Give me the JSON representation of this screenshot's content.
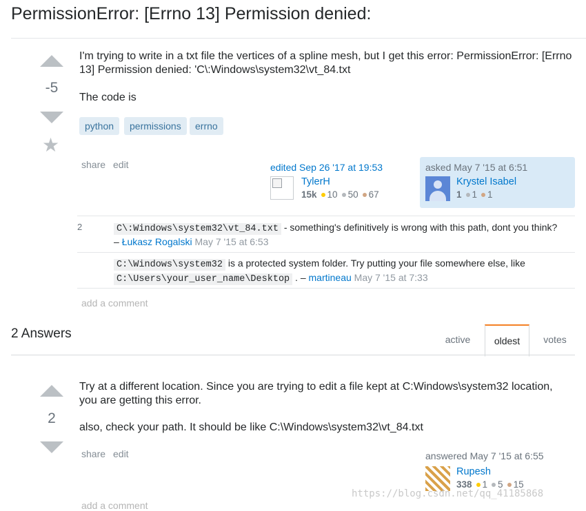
{
  "question": {
    "title": "PermissionError: [Errno 13] Permission denied:",
    "score": "-5",
    "body_p1": "I'm trying to write in a txt file the vertices of a spline mesh, but I get this error: PermissionError: [Errno 13] Permission denied: 'C\\:Windows\\system32\\vt_84.txt",
    "body_p2": "The code is",
    "tags": [
      "python",
      "permissions",
      "errno"
    ],
    "menu": {
      "share": "share",
      "edit": "edit"
    },
    "edited": {
      "action": "edited Sep 26 '17 at 19:53",
      "user": "TylerH",
      "rep": "15k",
      "gold": "10",
      "silver": "50",
      "bronze": "67"
    },
    "asked": {
      "action": "asked May 7 '15 at 6:51",
      "user": "Krystel Isabel",
      "rep": "1",
      "silver": "1",
      "bronze": "1"
    },
    "comments": [
      {
        "score": "2",
        "code": "C\\:Windows\\system32\\vt_84.txt",
        "text": " - something's definitively is wrong with this path, dont you think?",
        "dash": "– ",
        "user": "Łukasz Rogalski",
        "date": "May 7 '15 at 6:53"
      },
      {
        "code1": "C:\\Windows\\system32",
        "text1": " is a protected system folder. Try putting your file somewhere else, like",
        "code2": "C:\\Users\\your_user_name\\Desktop",
        "dash": " . – ",
        "user": "martineau",
        "date": "May 7 '15 at 7:33"
      }
    ],
    "add_comment": "add a comment"
  },
  "answers_header": {
    "count_label": "2 Answers",
    "tabs": [
      "active",
      "oldest",
      "votes"
    ],
    "selected_tab": "oldest"
  },
  "answer": {
    "score": "2",
    "body_p1": "Try at a different location. Since you are trying to edit a file kept at C:Windows\\system32 location, you are getting this error.",
    "body_p2": "also, check your path. It should be like C:\\Windows\\system32\\vt_84.txt",
    "menu": {
      "share": "share",
      "edit": "edit"
    },
    "answered": {
      "action": "answered May 7 '15 at 6:55",
      "user": "Rupesh",
      "rep": "338",
      "gold": "1",
      "silver": "5",
      "bronze": "15"
    },
    "add_comment": "add a comment"
  },
  "watermark": "https://blog.csdn.net/qq_41185868",
  "colors": {
    "link": "#0077cc",
    "tag_bg": "#e1ecf4",
    "tag_text": "#39739d",
    "owner_bg": "#d9eaf7",
    "tab_accent": "#f48024",
    "vote_arrow": "#bbc0c4"
  }
}
